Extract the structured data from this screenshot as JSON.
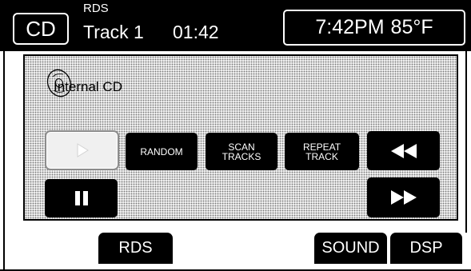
{
  "header": {
    "source_badge": "CD",
    "rds_label": "RDS",
    "track": "Track 1",
    "elapsed": "01:42",
    "clock": "7:42PM",
    "temperature": "85°F"
  },
  "panel": {
    "source_name": "Internal CD",
    "icons": {
      "disc": "cd-disc-icon"
    }
  },
  "controls": {
    "play": {
      "icon": "play-icon",
      "state": "inactive"
    },
    "random": "RANDOM",
    "scan_tracks": [
      "SCAN",
      "TRACKS"
    ],
    "repeat_track": [
      "REPEAT",
      "TRACK"
    ],
    "rewind": {
      "icon": "rewind-icon"
    },
    "pause": {
      "icon": "pause-icon"
    },
    "fast_forward": {
      "icon": "fast-forward-icon"
    }
  },
  "softkeys": {
    "rds": "RDS",
    "sound": "SOUND",
    "dsp": "DSP"
  },
  "colors": {
    "bar": "#000000",
    "panel_background": "#eeeeee",
    "button": "#000000",
    "button_text": "#ffffff",
    "inactive_button_border": "#8c8c8c"
  }
}
